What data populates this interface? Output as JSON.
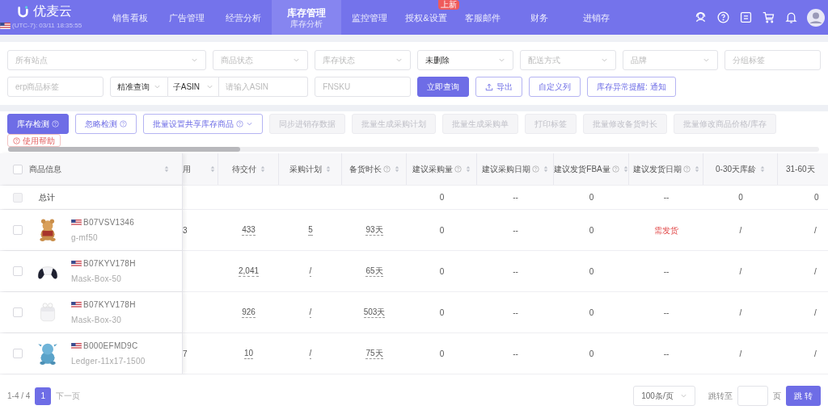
{
  "header": {
    "logo": "优麦云",
    "timezone": "(UTC-7): 03/11 18:35:55",
    "nav": [
      {
        "label": "销售看板",
        "selected": false
      },
      {
        "label": "广告管理",
        "selected": false
      },
      {
        "label": "经营分析",
        "selected": false
      },
      {
        "label": "库存管理",
        "subtitle": "库存分析",
        "selected": true
      },
      {
        "label": "监控管理",
        "selected": false
      },
      {
        "label": "授权&设置",
        "badge": "上新",
        "selected": false
      },
      {
        "label": "客服邮件",
        "selected": false
      },
      {
        "label": "财务",
        "selected": false
      },
      {
        "label": "进销存",
        "selected": false
      }
    ]
  },
  "filters": {
    "row_1": [
      {
        "kind": "select",
        "placeholder": "所有站点"
      },
      {
        "kind": "select",
        "placeholder": "商品状态"
      },
      {
        "kind": "select",
        "placeholder": "库存状态"
      },
      {
        "kind": "select",
        "value": "未删除"
      },
      {
        "kind": "select",
        "placeholder": "配送方式"
      },
      {
        "kind": "select",
        "placeholder": "品牌"
      },
      {
        "kind": "input",
        "placeholder": "分组标签"
      }
    ],
    "tag_field": {
      "placeholder": "erp商品标签"
    },
    "search_mode": "精准查询",
    "search_type": "子ASIN",
    "search_field": {
      "placeholder": "请输入ASIN"
    },
    "fnsku_field": {
      "placeholder": "FNSKU"
    },
    "buttons": [
      {
        "kind": "primary",
        "label": "立即查询"
      },
      {
        "kind": "export",
        "label": "导出"
      },
      {
        "kind": "outline",
        "label": "自定义列"
      },
      {
        "kind": "outline",
        "label": "库存异常提醒: 通知"
      }
    ]
  },
  "toolbar": [
    {
      "kind": "primary",
      "label": "库存检测",
      "help": true,
      "dropdown": false
    },
    {
      "kind": "outline",
      "label": "忽略检测",
      "help": true,
      "dropdown": false
    },
    {
      "kind": "outline",
      "label": "批量设置共享库存商品",
      "help": true,
      "dropdown": true
    },
    {
      "kind": "disabled",
      "label": "同步进销存数据",
      "help": false,
      "dropdown": false
    },
    {
      "kind": "disabled",
      "label": "批量生成采购计划",
      "help": false,
      "dropdown": false
    },
    {
      "kind": "disabled",
      "label": "批量生成采购单",
      "help": false,
      "dropdown": false
    },
    {
      "kind": "disabled",
      "label": "打印标签",
      "help": false,
      "dropdown": false
    },
    {
      "kind": "disabled",
      "label": "批量修改备货时长",
      "help": false,
      "dropdown": false
    },
    {
      "kind": "disabled",
      "label": "批量修改商品价格/库存",
      "help": false,
      "dropdown": false
    }
  ],
  "help_link": "使用帮助",
  "table": {
    "product_column": "商品信息",
    "all_checked": false,
    "total_label": "总计",
    "total_disabled": true,
    "cut_column": "用",
    "columns": [
      {
        "label": "待交付",
        "help": false,
        "kind": "dotted"
      },
      {
        "label": "采购计划",
        "help": false,
        "kind": "dotted"
      },
      {
        "label": "备货时长",
        "help": true,
        "kind": "dotted"
      },
      {
        "label": "建议采购量",
        "help": true,
        "kind": "plain"
      },
      {
        "label": "建议采购日期",
        "help": true,
        "kind": "plain"
      },
      {
        "label": "建议发货FBA量",
        "help": true,
        "kind": "plain"
      },
      {
        "label": "建议发货日期",
        "help": true,
        "kind": "status"
      },
      {
        "label": "0-30天库龄",
        "help": false,
        "kind": "plain"
      },
      {
        "label": "31-60天",
        "help": false,
        "kind": "cut_right"
      }
    ],
    "total": [
      "0",
      "--",
      "0",
      "--",
      "0",
      "0"
    ],
    "rows": [
      {
        "checked": false,
        "asin": "B07VSV1346",
        "sku": "g-mf50",
        "cut_value": "3",
        "needs_shipping": true,
        "cells": [
          "433",
          "5",
          "93天",
          "0",
          "--",
          "0",
          "需发货",
          "/",
          "/"
        ]
      },
      {
        "checked": false,
        "asin": "B07KYV178H",
        "sku": "Mask-Box-50",
        "needs_shipping": false,
        "cells": [
          "2,041",
          "/",
          "65天",
          "0",
          "--",
          "0",
          "--",
          "/",
          "/"
        ]
      },
      {
        "checked": false,
        "asin": "B07KYV178H",
        "sku": "Mask-Box-30",
        "needs_shipping": false,
        "cells": [
          "926",
          "/",
          "503天",
          "0",
          "--",
          "0",
          "--",
          "/",
          "/"
        ]
      },
      {
        "checked": false,
        "asin": "B000EFMD9C",
        "sku": "Ledger-11x17-1500",
        "cut_value": "7",
        "needs_shipping": false,
        "cells": [
          "10",
          "/",
          "75天",
          "0",
          "--",
          "0",
          "--",
          "/",
          "/"
        ]
      }
    ]
  },
  "pagination": {
    "range": "1-4 / 4",
    "page": "1",
    "next": "下一页",
    "page_size": "100条/页",
    "jump_label": "跳转至",
    "page_unit": "页",
    "jump_button": "跳 转"
  }
}
